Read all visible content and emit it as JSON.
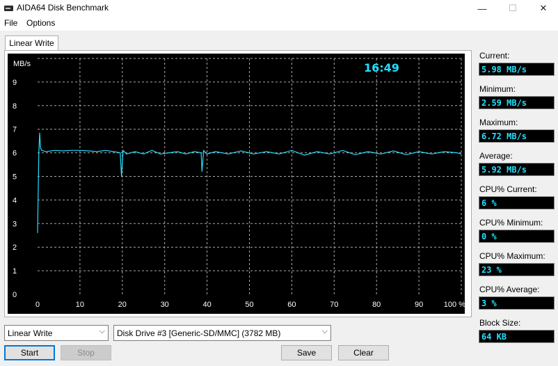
{
  "window": {
    "title": "AIDA64 Disk Benchmark",
    "minimize_glyph": "—",
    "maximize_glyph": "☐",
    "close_glyph": "✕"
  },
  "menu": [
    "File",
    "Options"
  ],
  "tab": "Linear Write",
  "chart": {
    "ylabel": "MB/s",
    "elapsed_time": "16:49",
    "line_color": "#22e0ff"
  },
  "chart_data": {
    "type": "line",
    "ylabel": "MB/s",
    "y_ticks": [
      "0",
      "1",
      "2",
      "3",
      "4",
      "5",
      "6",
      "7",
      "8",
      "9"
    ],
    "ylim": [
      0,
      10
    ],
    "x_ticks": [
      "0",
      "10",
      "20",
      "30",
      "40",
      "50",
      "60",
      "70",
      "80",
      "90",
      "100 %"
    ],
    "xlim": [
      0,
      100
    ],
    "grid": true,
    "series": [
      {
        "x": [
          0,
          0.3,
          0.5,
          0.7,
          1,
          2,
          4,
          6,
          8,
          10,
          12,
          14,
          16,
          18,
          19.5,
          19.8,
          20.2,
          21,
          23,
          25,
          27,
          29,
          31,
          33,
          35,
          37,
          38.6,
          38.8,
          39.2,
          40,
          42,
          45,
          48,
          51,
          54,
          57,
          60,
          63,
          66,
          69,
          72,
          75,
          78,
          81,
          84,
          87,
          90,
          93,
          96,
          99,
          100
        ],
        "y": [
          2.6,
          6.0,
          6.85,
          6.2,
          6.1,
          6.05,
          6.1,
          6.08,
          6.1,
          6.1,
          6.08,
          6.05,
          6.1,
          6.05,
          6.0,
          5.0,
          6.1,
          5.95,
          6.05,
          5.95,
          6.1,
          5.95,
          6.0,
          6.05,
          5.95,
          6.05,
          6.0,
          5.2,
          6.1,
          5.95,
          6.05,
          5.95,
          6.08,
          5.95,
          6.05,
          5.95,
          6.1,
          5.9,
          6.05,
          5.95,
          6.1,
          5.92,
          6.05,
          5.95,
          6.08,
          5.92,
          6.05,
          5.95,
          6.05,
          6.0,
          5.95
        ]
      }
    ]
  },
  "stats": [
    {
      "label": "Current:",
      "value": "5.98 MB/s"
    },
    {
      "label": "Minimum:",
      "value": "2.59 MB/s"
    },
    {
      "label": "Maximum:",
      "value": "6.72 MB/s"
    },
    {
      "label": "Average:",
      "value": "5.92 MB/s"
    },
    {
      "label": "CPU% Current:",
      "value": "6 %"
    },
    {
      "label": "CPU% Minimum:",
      "value": "0 %"
    },
    {
      "label": "CPU% Maximum:",
      "value": "23 %"
    },
    {
      "label": "CPU% Average:",
      "value": "3 %"
    },
    {
      "label": "Block Size:",
      "value": "64 KB"
    }
  ],
  "controls": {
    "test_select": "Linear Write",
    "drive_select": "Disk Drive #3  [Generic-SD/MMC]  (3782 MB)",
    "chevron_glyph": "⌵",
    "start": "Start",
    "stop": "Stop",
    "save": "Save",
    "clear": "Clear"
  }
}
